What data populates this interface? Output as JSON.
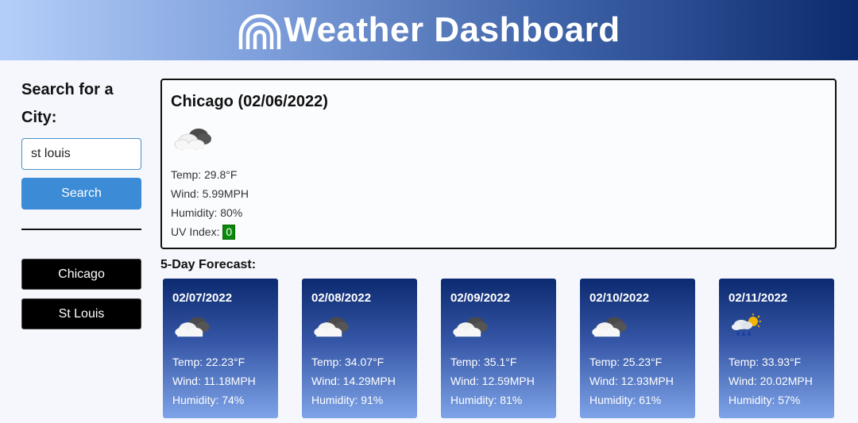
{
  "header": {
    "title": "Weather Dashboard",
    "logo_icon": "rainbow-icon"
  },
  "sidebar": {
    "search_title": "Search for a City:",
    "search_value": "st louis",
    "search_button_label": "Search",
    "history": [
      "Chicago",
      "St Louis"
    ]
  },
  "current": {
    "title": "Chicago (02/06/2022)",
    "icon": "cloud-icon",
    "temp": "Temp: 29.8°F",
    "wind": "Wind: 5.99MPH",
    "humidity": "Humidity: 80%",
    "uv_label": "UV Index:",
    "uv_value": "0",
    "uv_color": "#0a8a0a"
  },
  "forecast": {
    "title": "5-Day Forecast:",
    "days": [
      {
        "date": "02/07/2022",
        "icon": "cloud-icon",
        "temp": "Temp: 22.23°F",
        "wind": "Wind: 11.18MPH",
        "humidity": "Humidity: 74%"
      },
      {
        "date": "02/08/2022",
        "icon": "cloud-icon",
        "temp": "Temp: 34.07°F",
        "wind": "Wind: 14.29MPH",
        "humidity": "Humidity: 91%"
      },
      {
        "date": "02/09/2022",
        "icon": "cloud-icon",
        "temp": "Temp: 35.1°F",
        "wind": "Wind: 12.59MPH",
        "humidity": "Humidity: 81%"
      },
      {
        "date": "02/10/2022",
        "icon": "cloud-icon",
        "temp": "Temp: 25.23°F",
        "wind": "Wind: 12.93MPH",
        "humidity": "Humidity: 61%"
      },
      {
        "date": "02/11/2022",
        "icon": "rain-sun-icon",
        "temp": "Temp: 33.93°F",
        "wind": "Wind: 20.02MPH",
        "humidity": "Humidity: 57%"
      }
    ]
  },
  "colors": {
    "search_button": "#3b8bd6",
    "header_start": "#b5cff9",
    "header_end": "#0c2a6e",
    "card_top": "#0c2a70",
    "card_bottom": "#7fa4e8"
  }
}
